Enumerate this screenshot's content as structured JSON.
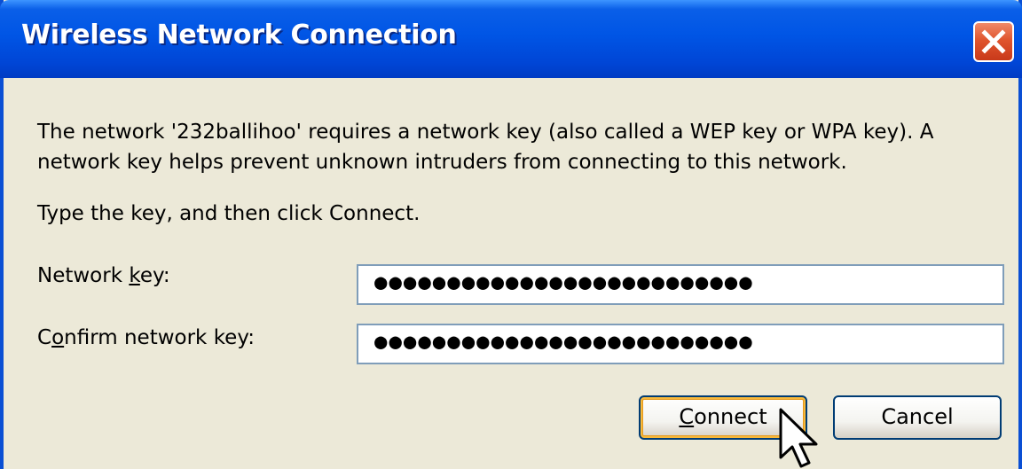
{
  "window": {
    "title": "Wireless Network Connection",
    "close_icon": "close-x-icon"
  },
  "message": {
    "description": "The network '232ballihoo' requires a network key (also called a WEP key or WPA key). A network key helps prevent unknown intruders from connecting to this network.",
    "instruction": "Type the key, and then click Connect."
  },
  "form": {
    "network_key": {
      "label_before": "Network ",
      "label_accel": "k",
      "label_after": "ey:",
      "masked_value": "●●●●●●●●●●●●●●●●●●●●●●●●●●"
    },
    "confirm_key": {
      "label_before": "C",
      "label_accel": "o",
      "label_after": "nfirm network key:",
      "masked_value": "●●●●●●●●●●●●●●●●●●●●●●●●●●"
    }
  },
  "buttons": {
    "connect": {
      "accel": "C",
      "rest": "onnect"
    },
    "cancel_label": "Cancel"
  },
  "colors": {
    "titlebar": "#0055e5",
    "dialog_bg": "#ece9d8",
    "close_button": "#e0552e",
    "default_button_highlight": "#f8b93a",
    "field_border": "#7f9db9"
  },
  "cursor_icon": "arrow-cursor-icon"
}
